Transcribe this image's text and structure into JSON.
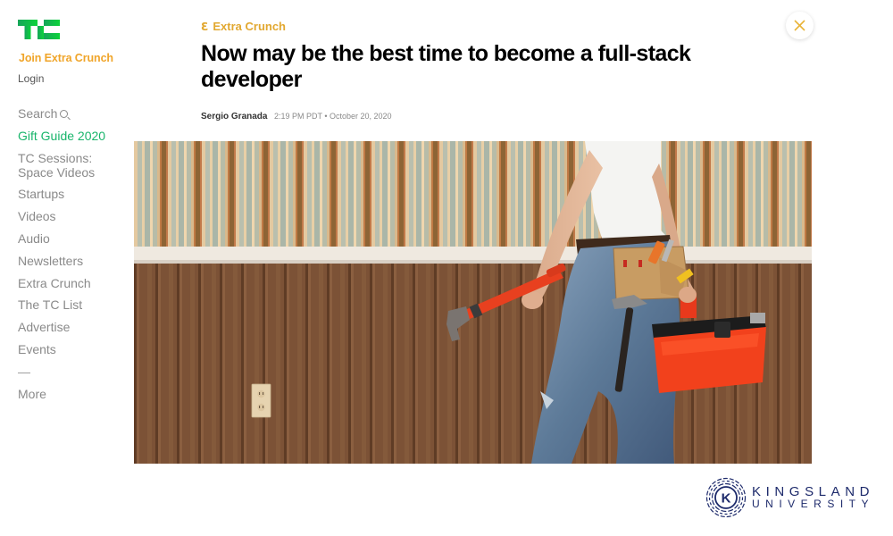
{
  "sidebar": {
    "logo": "TC",
    "join_label": "Join Extra Crunch",
    "login_label": "Login",
    "nav": [
      {
        "label": "Search",
        "icon": "search-icon"
      },
      {
        "label": "Gift Guide 2020"
      },
      {
        "label": "TC Sessions: Space Videos"
      },
      {
        "label": "Startups"
      },
      {
        "label": "Videos"
      },
      {
        "label": "Audio"
      },
      {
        "label": "Newsletters"
      },
      {
        "label": "Extra Crunch"
      },
      {
        "label": "The TC List"
      },
      {
        "label": "Advertise"
      },
      {
        "label": "Events"
      },
      {
        "label": "—"
      },
      {
        "label": "More"
      }
    ]
  },
  "article": {
    "kicker_icon": "extra-crunch-icon",
    "kicker_glyph": "Ɛ",
    "kicker": "Extra Crunch",
    "title": "Now may be the best time to become a full-stack developer",
    "author": "Sergio Granada",
    "timestamp": "2:19 PM PDT • October 20, 2020",
    "image_alt": "Woman in jeans carrying a pipe wrench, tool belt and red toolbox in front of striped wallpaper and wood paneling"
  },
  "close": {
    "icon": "close-icon"
  },
  "watermark": {
    "monogram": "K",
    "line1": "KINGSLAND",
    "line2": "UNIVERSITY"
  },
  "colors": {
    "tc_green": "#0a9e01",
    "extra_crunch_orange": "#f0a52a",
    "highlight_green": "#19b56b",
    "kingsland_navy": "#1d2a6b"
  }
}
